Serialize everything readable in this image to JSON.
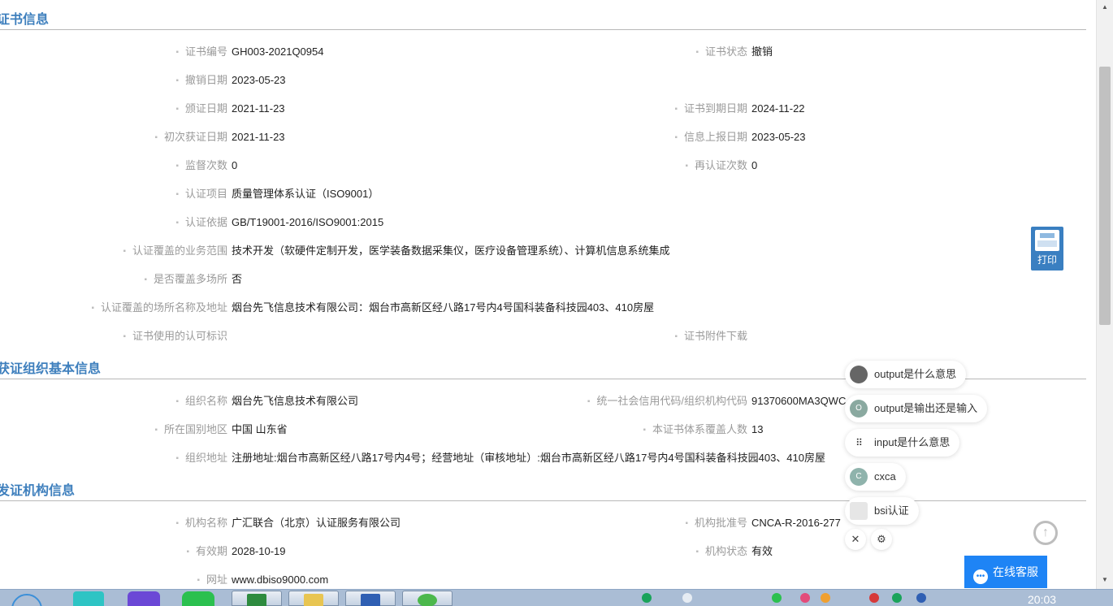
{
  "sections": {
    "cert_title": "证书信息",
    "org_title": "获证组织基本信息",
    "agency_title": "发证机构信息"
  },
  "cert": {
    "cert_no_label": "证书编号",
    "cert_no": "GH003-2021Q0954",
    "status_label": "证书状态",
    "status": "撤销",
    "revoke_date_label": "撤销日期",
    "revoke_date": "2023-05-23",
    "issue_date_label": "颁证日期",
    "issue_date": "2021-11-23",
    "expire_date_label": "证书到期日期",
    "expire_date": "2024-11-22",
    "first_date_label": "初次获证日期",
    "first_date": "2021-11-23",
    "report_date_label": "信息上报日期",
    "report_date": "2023-05-23",
    "supervise_label": "监督次数",
    "supervise": "0",
    "recert_label": "再认证次数",
    "recert": "0",
    "item_label": "认证项目",
    "item": "质量管理体系认证（ISO9001）",
    "basis_label": "认证依据",
    "basis": "GB/T19001-2016/ISO9001:2015",
    "scope_label": "认证覆盖的业务范围",
    "scope": "技术开发（软硬件定制开发，医学装备数据采集仪，医疗设备管理系统）、计算机信息系统集成",
    "multi_site_label": "是否覆盖多场所",
    "multi_site": "否",
    "site_label": "认证覆盖的场所名称及地址",
    "site": "烟台先飞信息技术有限公司：烟台市高新区经八路17号内4号国科装备科技园403、410房屋",
    "mark_label": "证书使用的认可标识",
    "attach_label": "证书附件下载"
  },
  "org": {
    "name_label": "组织名称",
    "name": "烟台先飞信息技术有限公司",
    "credit_label": "统一社会信用代码/组织机构代码",
    "credit": "91370600MA3QWC",
    "region_label": "所在国别地区",
    "region": "中国 山东省",
    "headcount_label": "本证书体系覆盖人数",
    "headcount": "13",
    "address_label": "组织地址",
    "address": "注册地址:烟台市高新区经八路17号内4号；经营地址（审核地址）:烟台市高新区经八路17号内4号国科装备科技园403、410房屋"
  },
  "agency": {
    "name_label": "机构名称",
    "name": "广汇联合（北京）认证服务有限公司",
    "approval_label": "机构批准号",
    "approval": "CNCA-R-2016-277",
    "valid_label": "有效期",
    "valid": "2028-10-19",
    "status_label": "机构状态",
    "status": "有效",
    "site_label": "网址",
    "site": "www.dbiso9000.com"
  },
  "print_label": "打印",
  "suggestions": [
    {
      "text": "output是什么意思",
      "icon": "avatar-gray",
      "color": "#666666"
    },
    {
      "text": "output是输出还是输入",
      "icon": "avatar-o",
      "glyph": "O",
      "color": "#8aa9a0"
    },
    {
      "text": "input是什么意思",
      "icon": "avatar-dots",
      "color": "#555555"
    },
    {
      "text": "cxca",
      "icon": "avatar-c",
      "glyph": "C",
      "color": "#8fb3ac"
    },
    {
      "text": "bsi认证",
      "icon": "avatar-doc",
      "color": "#b0b0b0"
    }
  ],
  "service_label": "在线客服",
  "clock": "20:03",
  "colors": {
    "accent": "#3e7fbd",
    "service": "#1e84f5"
  }
}
